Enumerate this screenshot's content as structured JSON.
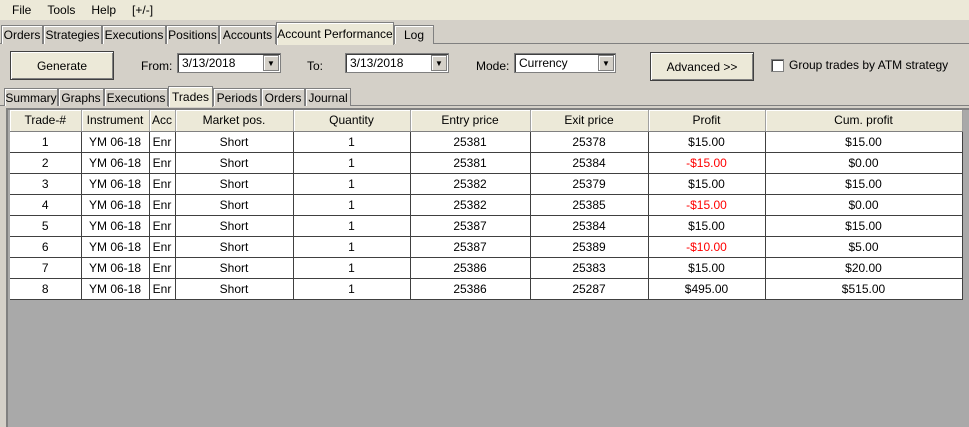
{
  "menu": [
    "File",
    "Tools",
    "Help",
    "[+/-]"
  ],
  "main_tabs": [
    "Orders",
    "Strategies",
    "Executions",
    "Positions",
    "Accounts",
    "Account Performance",
    "Log"
  ],
  "toolbar": {
    "generate_label": "Generate",
    "from_label": "From:",
    "from_value": "3/13/2018",
    "to_label": "To:",
    "to_value": "3/13/2018",
    "mode_label": "Mode:",
    "mode_value": "Currency",
    "advanced_label": "Advanced >>",
    "group_label": "Group trades by ATM strategy",
    "group_checked": false
  },
  "sub_tabs": [
    "Summary",
    "Graphs",
    "Executions",
    "Trades",
    "Periods",
    "Orders",
    "Journal"
  ],
  "table": {
    "headers": [
      "Trade-#",
      "Instrument",
      "Acc",
      "Market pos.",
      "Quantity",
      "Entry price",
      "Exit price",
      "Profit",
      "Cum. profit"
    ],
    "rows": [
      [
        "1",
        "YM 06-18",
        "Enr",
        "Short",
        "1",
        "25381",
        "25378",
        "$15.00",
        "$15.00"
      ],
      [
        "2",
        "YM 06-18",
        "Enr",
        "Short",
        "1",
        "25381",
        "25384",
        "-$15.00",
        "$0.00"
      ],
      [
        "3",
        "YM 06-18",
        "Enr",
        "Short",
        "1",
        "25382",
        "25379",
        "$15.00",
        "$15.00"
      ],
      [
        "4",
        "YM 06-18",
        "Enr",
        "Short",
        "1",
        "25382",
        "25385",
        "-$15.00",
        "$0.00"
      ],
      [
        "5",
        "YM 06-18",
        "Enr",
        "Short",
        "1",
        "25387",
        "25384",
        "$15.00",
        "$15.00"
      ],
      [
        "6",
        "YM 06-18",
        "Enr",
        "Short",
        "1",
        "25387",
        "25389",
        "-$10.00",
        "$5.00"
      ],
      [
        "7",
        "YM 06-18",
        "Enr",
        "Short",
        "1",
        "25386",
        "25383",
        "$15.00",
        "$20.00"
      ],
      [
        "8",
        "YM 06-18",
        "Enr",
        "Short",
        "1",
        "25386",
        "25287",
        "$495.00",
        "$515.00"
      ]
    ]
  },
  "colors": {
    "negative": "#ff0000",
    "grid_background": "#a9a9a9"
  }
}
